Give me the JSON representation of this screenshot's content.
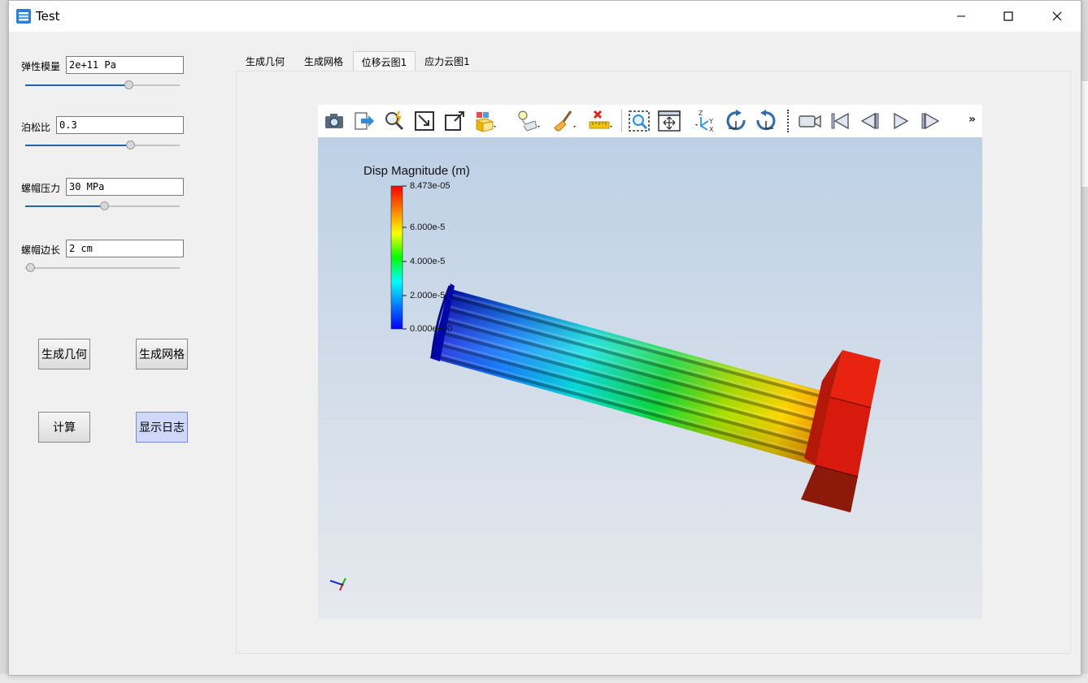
{
  "window": {
    "title": "Test"
  },
  "params": {
    "modulus": {
      "label": "弹性模量",
      "value": "2e+11 Pa",
      "slider": 0.67
    },
    "poisson": {
      "label": "泊松比",
      "value": "0.3",
      "slider": 0.68
    },
    "pressure": {
      "label": "螺帽压力",
      "value": "30 MPa",
      "slider": 0.51
    },
    "side": {
      "label": "螺帽边长",
      "value": "2 cm",
      "slider": 0.0
    }
  },
  "buttons": {
    "geometry": "生成几何",
    "mesh": "生成网格",
    "compute": "计算",
    "log": "显示日志"
  },
  "tabs": [
    "生成几何",
    "生成网格",
    "位移云图1",
    "应力云图1"
  ],
  "active_tab": 2,
  "viewer": {
    "toolbar_icons": [
      "camera-icon",
      "export-icon",
      "find-data-icon",
      "reset-camera-icon",
      "zoom-to-data-icon",
      "color-palette-icon",
      "light-icon",
      "paintbrush-icon",
      "ruler-icon",
      "zoom-to-box-icon",
      "fit-window-icon",
      "axes-orientation-icon",
      "rotate-cw-icon",
      "rotate-ccw-icon",
      "record-camera-icon",
      "first-frame-icon",
      "previous-frame-icon",
      "play-icon",
      "next-frame-icon"
    ],
    "toolbar_more": "»",
    "colorbar": {
      "title": "Disp Magnitude (m)",
      "max_label": "8.473e-05",
      "ticks": [
        "6.000e-5",
        "4.000e-5",
        "2.000e-5",
        "0.000e+00"
      ],
      "colors": [
        "#ff0000",
        "#ff8000",
        "#ffff00",
        "#00ff00",
        "#00ffff",
        "#0080ff",
        "#0000ff"
      ]
    }
  }
}
